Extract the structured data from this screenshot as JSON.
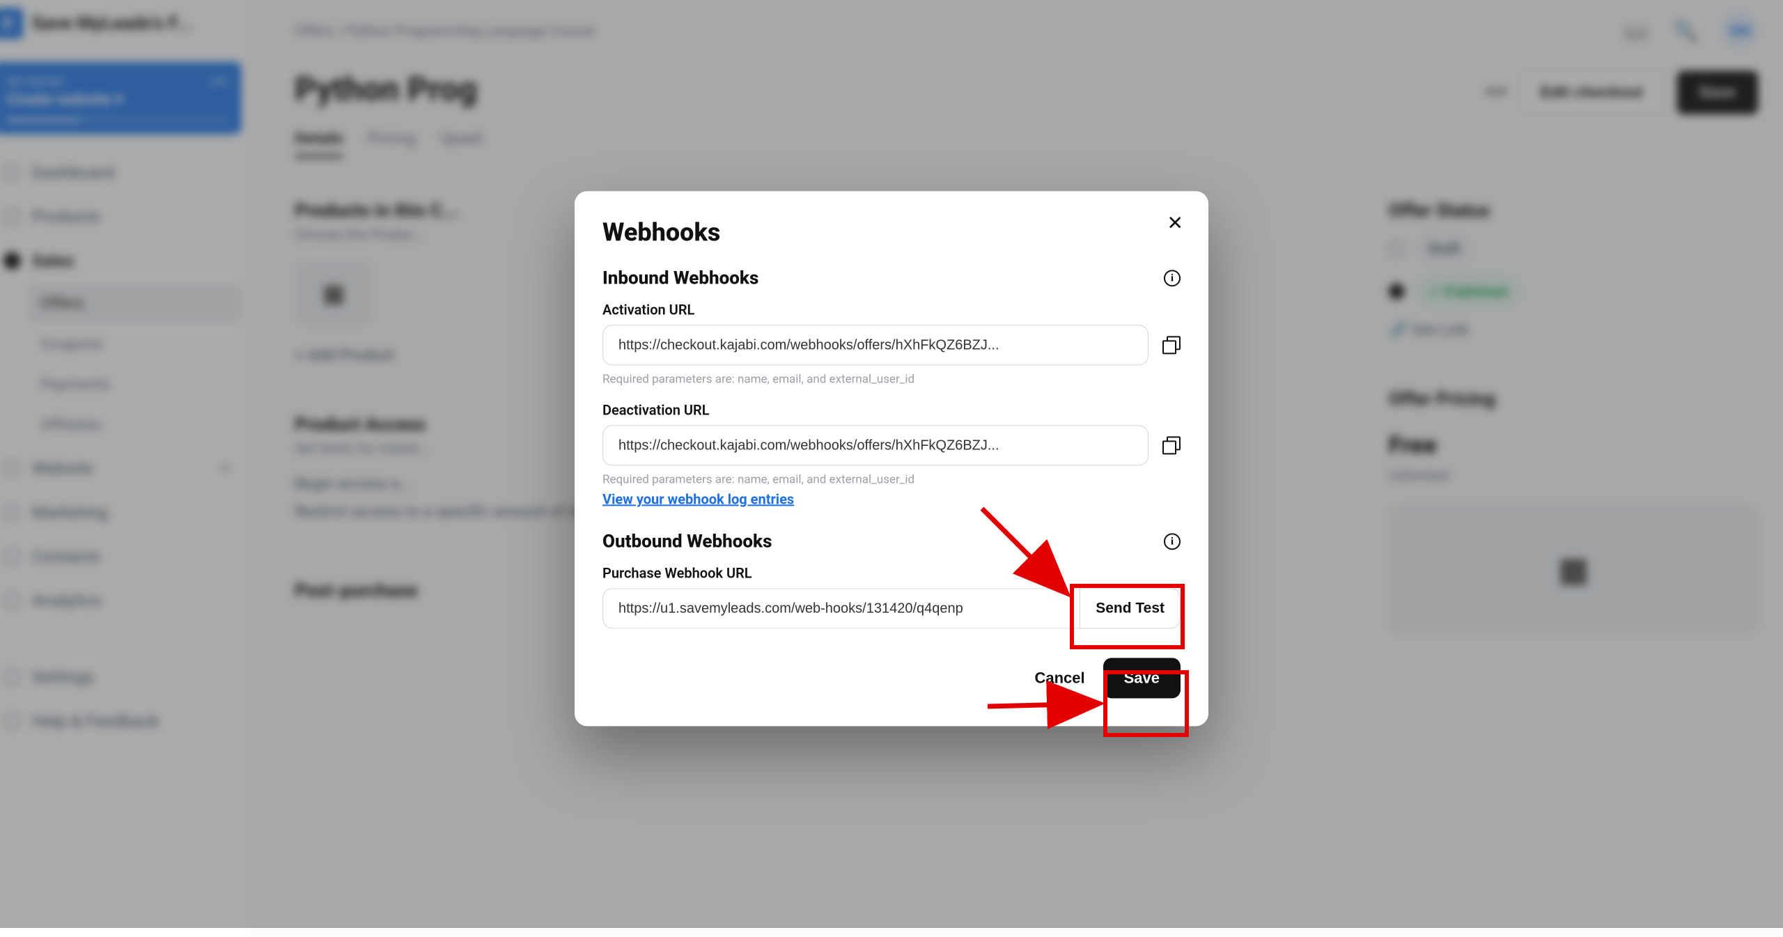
{
  "brand": {
    "initial": "K",
    "name": "Save MyLeads's F..."
  },
  "cta": {
    "small": "Get Started",
    "big": "Create website  ▾",
    "count": "2/6"
  },
  "nav": {
    "dashboard": "Dashboard",
    "products": "Products",
    "sales": "Sales",
    "website": "Website",
    "marketing": "Marketing",
    "contacts": "Contacts",
    "analytics": "Analytics",
    "settings": "Settings",
    "help": "Help & Feedback",
    "sub": {
      "offers": "Offers",
      "coupons": "Coupons",
      "payments": "Payments",
      "affiliates": "Affiliates"
    }
  },
  "breadcrumb": {
    "root": "Offers",
    "sep": "/",
    "leaf": "Python Programming Language Course"
  },
  "top": {
    "avatar": "SM"
  },
  "page": {
    "title": "Python Prog",
    "edit_checkout": "Edit checkout",
    "save": "Save",
    "more": "•••"
  },
  "tabs": {
    "details": "Details",
    "pricing": "Pricing",
    "upsell": "Upsell"
  },
  "products": {
    "title": "Products in this C...",
    "sub": "Choose the Produc...",
    "add": "+  Add Product"
  },
  "access": {
    "title": "Product Access",
    "sub": "Set limits for memb...",
    "r1": "Begin access a...",
    "r2": "Restrict access to a specific amount of days"
  },
  "post": {
    "title": "Post-purchase"
  },
  "status": {
    "title": "Offer Status",
    "draft": "Draft",
    "published": "Published",
    "getlink": "Get Link",
    "link_icon": "🔗"
  },
  "pricing": {
    "title": "Offer Pricing",
    "free": "Free",
    "unlimited": "Unlimited"
  },
  "modal": {
    "title": "Webhooks",
    "inbound_title": "Inbound Webhooks",
    "activation_label": "Activation URL",
    "activation_value": "https://checkout.kajabi.com/webhooks/offers/hXhFkQZ6BZJ...",
    "required_hint": "Required parameters are: name, email, and external_user_id",
    "deactivation_label": "Deactivation URL",
    "deactivation_value": "https://checkout.kajabi.com/webhooks/offers/hXhFkQZ6BZJ...",
    "log_link": "View your webhook log entries",
    "outbound_title": "Outbound Webhooks",
    "purchase_label": "Purchase Webhook URL",
    "purchase_value": "https://u1.savemyleads.com/web-hooks/131420/q4qenp",
    "send_test": "Send Test",
    "cancel": "Cancel",
    "save": "Save"
  }
}
